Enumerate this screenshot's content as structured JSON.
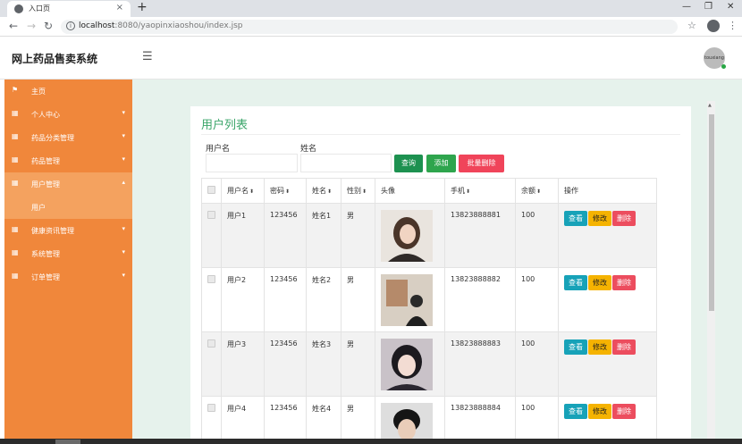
{
  "browser": {
    "tab_title": "入口页",
    "tab_close": "×",
    "new_tab": "+",
    "url_host": "localhost",
    "url_rest": ":8080/yaopinxiaoshou/index.jsp",
    "win_minimize": "—",
    "win_restore": "❐",
    "win_close": "✕"
  },
  "header": {
    "brand": "网上药品售卖系统",
    "avatar_text": "touxiang"
  },
  "sidebar": {
    "items": [
      {
        "label": "主页",
        "icon": "flag-icon",
        "caret": ""
      },
      {
        "label": "个人中心",
        "icon": "grid-icon",
        "caret": "▾"
      },
      {
        "label": "药品分类管理",
        "icon": "grid-icon",
        "caret": "▾"
      },
      {
        "label": "药品管理",
        "icon": "grid-icon",
        "caret": "▾"
      },
      {
        "label": "用户管理",
        "icon": "grid-icon",
        "caret": "▴"
      },
      {
        "label": "用户",
        "icon": "",
        "caret": ""
      },
      {
        "label": "健康资讯管理",
        "icon": "grid-icon",
        "caret": "▾"
      },
      {
        "label": "系统管理",
        "icon": "grid-icon",
        "caret": "▾"
      },
      {
        "label": "订单管理",
        "icon": "grid-icon",
        "caret": "▾"
      }
    ]
  },
  "main": {
    "title": "用户列表",
    "search": {
      "username_label": "用户名",
      "username_value": "",
      "name_label": "姓名",
      "name_value": "",
      "query_button": "查询",
      "add_button": "添加",
      "batch_delete_button": "批量删除"
    },
    "table": {
      "headers": [
        "用户名",
        "密码",
        "姓名",
        "性别",
        "头像",
        "手机",
        "余额",
        "操作"
      ],
      "rows": [
        {
          "username": "用户1",
          "password": "123456",
          "name": "姓名1",
          "gender": "男",
          "phone": "13823888881",
          "balance": "100"
        },
        {
          "username": "用户2",
          "password": "123456",
          "name": "姓名2",
          "gender": "男",
          "phone": "13823888882",
          "balance": "100"
        },
        {
          "username": "用户3",
          "password": "123456",
          "name": "姓名3",
          "gender": "男",
          "phone": "13823888883",
          "balance": "100"
        },
        {
          "username": "用户4",
          "password": "123456",
          "name": "姓名4",
          "gender": "男",
          "phone": "13823888884",
          "balance": "100"
        }
      ],
      "actions": {
        "view": "查看",
        "edit": "修改",
        "delete": "删除"
      }
    }
  },
  "colors": {
    "sidebar": "#f0873b",
    "sidebar_active": "#f4a25f",
    "title_green": "#3aa569",
    "page_bg": "#e6f2ec"
  }
}
